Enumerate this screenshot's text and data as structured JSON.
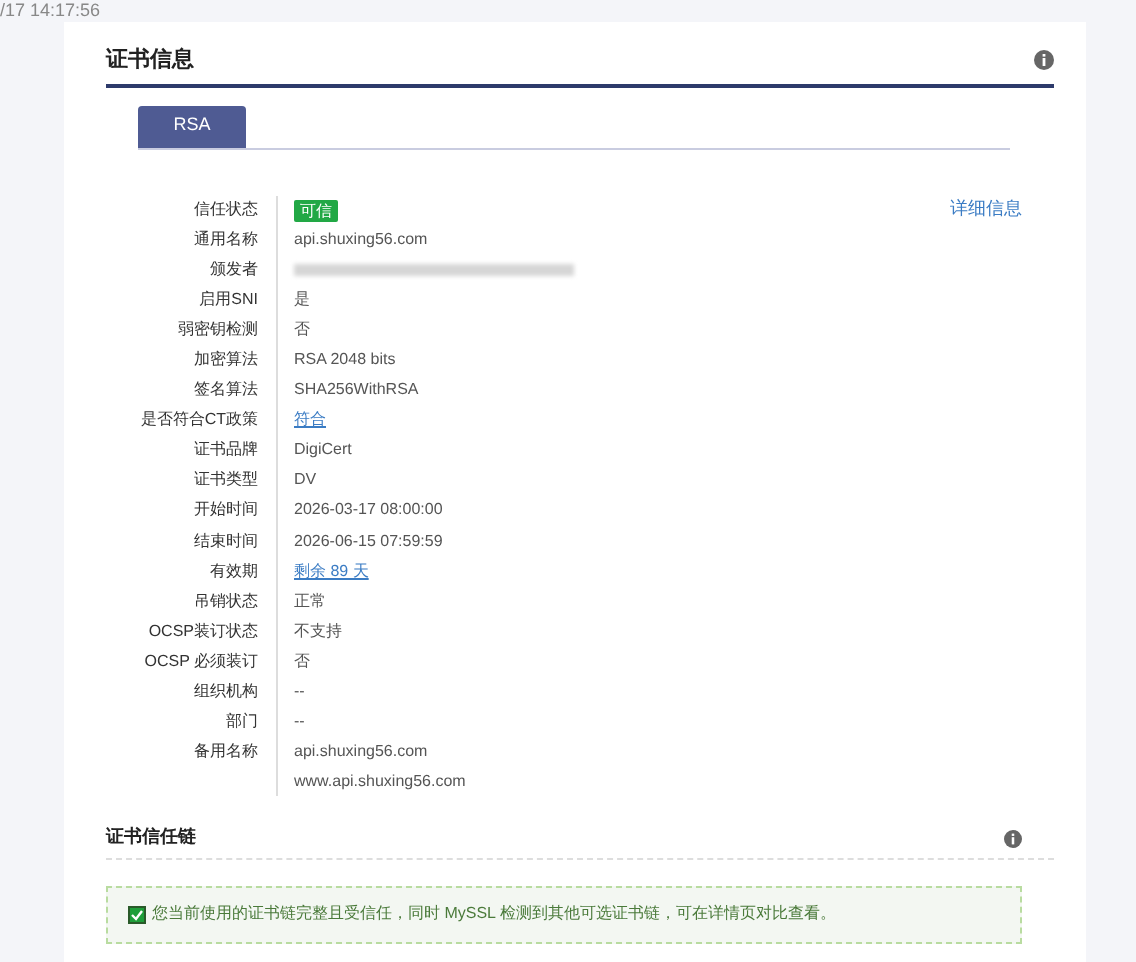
{
  "top_bar": {
    "timestamp": "/17 14:17:56"
  },
  "cert_info": {
    "title": "证书信息",
    "tabs": [
      {
        "label": "RSA",
        "selected": true
      }
    ],
    "details_link": "详细信息",
    "rows": [
      {
        "label": "信任状态",
        "value": "可信",
        "kind": "badge"
      },
      {
        "label": "通用名称",
        "value": "api.shuxing56.com",
        "kind": "text"
      },
      {
        "label": "颁发者",
        "kind": "redacted"
      },
      {
        "label": "启用SNI",
        "value": "是",
        "kind": "text"
      },
      {
        "label": "弱密钥检测",
        "value": "否",
        "kind": "text"
      },
      {
        "label": "加密算法",
        "value": "RSA 2048 bits",
        "kind": "text"
      },
      {
        "label": "签名算法",
        "value": "SHA256WithRSA",
        "kind": "text"
      },
      {
        "label": "是否符合CT政策",
        "value": "符合",
        "kind": "link"
      },
      {
        "label": "证书品牌",
        "value": "DigiCert",
        "kind": "text"
      },
      {
        "label": "证书类型",
        "value": "DV",
        "kind": "text"
      },
      {
        "label": "开始时间",
        "value": "2026-03-17 08:00:00",
        "kind": "text"
      },
      {
        "label": "结束时间",
        "value": "2026-06-15 07:59:59",
        "kind": "text"
      },
      {
        "label": "有效期",
        "value": "剩余 89 天",
        "kind": "link"
      },
      {
        "label": "吊销状态",
        "value": "正常",
        "kind": "text"
      },
      {
        "label": "OCSP装订状态",
        "value": "不支持",
        "kind": "text"
      },
      {
        "label": "OCSP 必须装订",
        "value": "否",
        "kind": "text"
      },
      {
        "label": "组织机构",
        "value": "--",
        "kind": "text"
      },
      {
        "label": "部门",
        "value": "--",
        "kind": "text"
      },
      {
        "label": "备用名称",
        "value": "api.shuxing56.com",
        "kind": "text"
      },
      {
        "value": "www.api.shuxing56.com",
        "kind": "text"
      }
    ]
  },
  "trust_chain": {
    "title": "证书信任链",
    "notice": {
      "text": "您当前使用的证书链完整且受信任，同时 MySSL 检测到其他可选证书链，可在详情页对比查看。",
      "checked": true
    }
  }
}
